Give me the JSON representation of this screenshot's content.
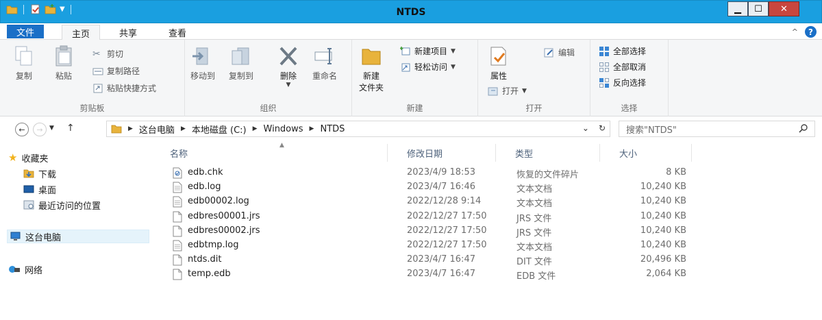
{
  "window": {
    "title": "NTDS",
    "min_label": "▁",
    "max_label": "☐",
    "close_label": "✕"
  },
  "ribbon_tabs": {
    "file": "文件",
    "home": "主页",
    "share": "共享",
    "view": "查看"
  },
  "ribbon": {
    "clipboard": {
      "copy": "复制",
      "paste": "粘贴",
      "cut": "剪切",
      "copy_path": "复制路径",
      "paste_shortcut": "粘贴快捷方式",
      "group": "剪贴板"
    },
    "organize": {
      "move_to": "移动到",
      "copy_to": "复制到",
      "delete": "删除",
      "rename": "重命名",
      "group": "组织"
    },
    "new": {
      "new_folder_line1": "新建",
      "new_folder_line2": "文件夹",
      "new_item": "新建项目",
      "easy_access": "轻松访问",
      "group": "新建"
    },
    "open": {
      "properties": "属性",
      "open": "打开",
      "edit": "编辑",
      "group": "打开"
    },
    "select": {
      "select_all": "全部选择",
      "select_none": "全部取消",
      "invert": "反向选择",
      "group": "选择"
    }
  },
  "address": {
    "crumbs": [
      "这台电脑",
      "本地磁盘 (C:)",
      "Windows",
      "NTDS"
    ],
    "search_placeholder": "搜索\"NTDS\""
  },
  "nav": {
    "favorites": "收藏夹",
    "downloads": "下载",
    "desktop": "桌面",
    "recent": "最近访问的位置",
    "this_pc": "这台电脑",
    "network": "网络"
  },
  "columns": {
    "name": "名称",
    "date": "修改日期",
    "type": "类型",
    "size": "大小"
  },
  "files": [
    {
      "name": "edb.chk",
      "date": "2023/4/9 18:53",
      "type": "恢复的文件碎片",
      "size": "8 KB",
      "icon": "chk-file-icon"
    },
    {
      "name": "edb.log",
      "date": "2023/4/7 16:46",
      "type": "文本文档",
      "size": "10,240 KB",
      "icon": "text-file-icon"
    },
    {
      "name": "edb00002.log",
      "date": "2022/12/28 9:14",
      "type": "文本文档",
      "size": "10,240 KB",
      "icon": "text-file-icon"
    },
    {
      "name": "edbres00001.jrs",
      "date": "2022/12/27 17:50",
      "type": "JRS 文件",
      "size": "10,240 KB",
      "icon": "blank-file-icon"
    },
    {
      "name": "edbres00002.jrs",
      "date": "2022/12/27 17:50",
      "type": "JRS 文件",
      "size": "10,240 KB",
      "icon": "blank-file-icon"
    },
    {
      "name": "edbtmp.log",
      "date": "2022/12/27 17:50",
      "type": "文本文档",
      "size": "10,240 KB",
      "icon": "text-file-icon"
    },
    {
      "name": "ntds.dit",
      "date": "2023/4/7 16:47",
      "type": "DIT 文件",
      "size": "20,496 KB",
      "icon": "blank-file-icon"
    },
    {
      "name": "temp.edb",
      "date": "2023/4/7 16:47",
      "type": "EDB 文件",
      "size": "2,064 KB",
      "icon": "blank-file-icon"
    }
  ],
  "colors": {
    "titlebar": "#1a9fe0",
    "file_tab": "#1a6fc7",
    "ribbon_bg": "#f5f6f7",
    "selected_nav": "#e5f3fb",
    "folder": "#e8b33c"
  }
}
